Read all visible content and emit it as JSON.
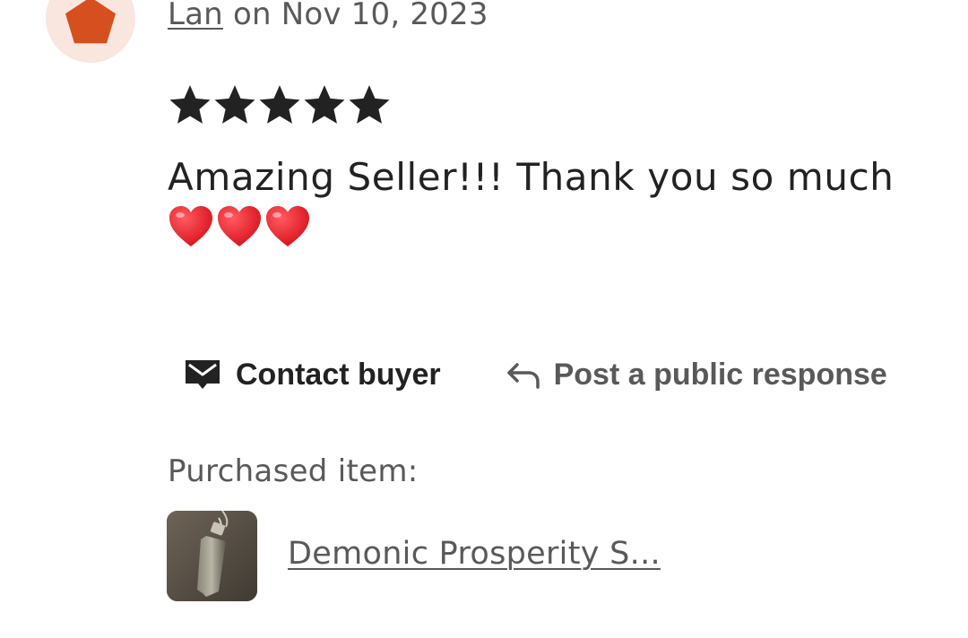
{
  "review": {
    "reviewer_name": "Lan",
    "date_text": " on Nov 10, 2023",
    "rating": 5,
    "rating_max": 5,
    "text": "Amazing Seller!!! Thank you so much",
    "emojis": [
      "heart",
      "heart",
      "heart"
    ]
  },
  "avatar": {
    "icon": "pentagon-icon",
    "color": "#d64f1e",
    "bg": "#f8e6df"
  },
  "actions": {
    "contact_label": "Contact buyer",
    "contact_icon": "mail-icon",
    "respond_label": "Post a public response",
    "respond_icon": "reply-arrow-icon"
  },
  "purchase": {
    "label": "Purchased item:",
    "item_name": "Demonic Prosperity S..."
  },
  "colors": {
    "star": "#222222",
    "text_primary": "#222222",
    "text_secondary": "#595959",
    "heart": "#e8202b"
  }
}
